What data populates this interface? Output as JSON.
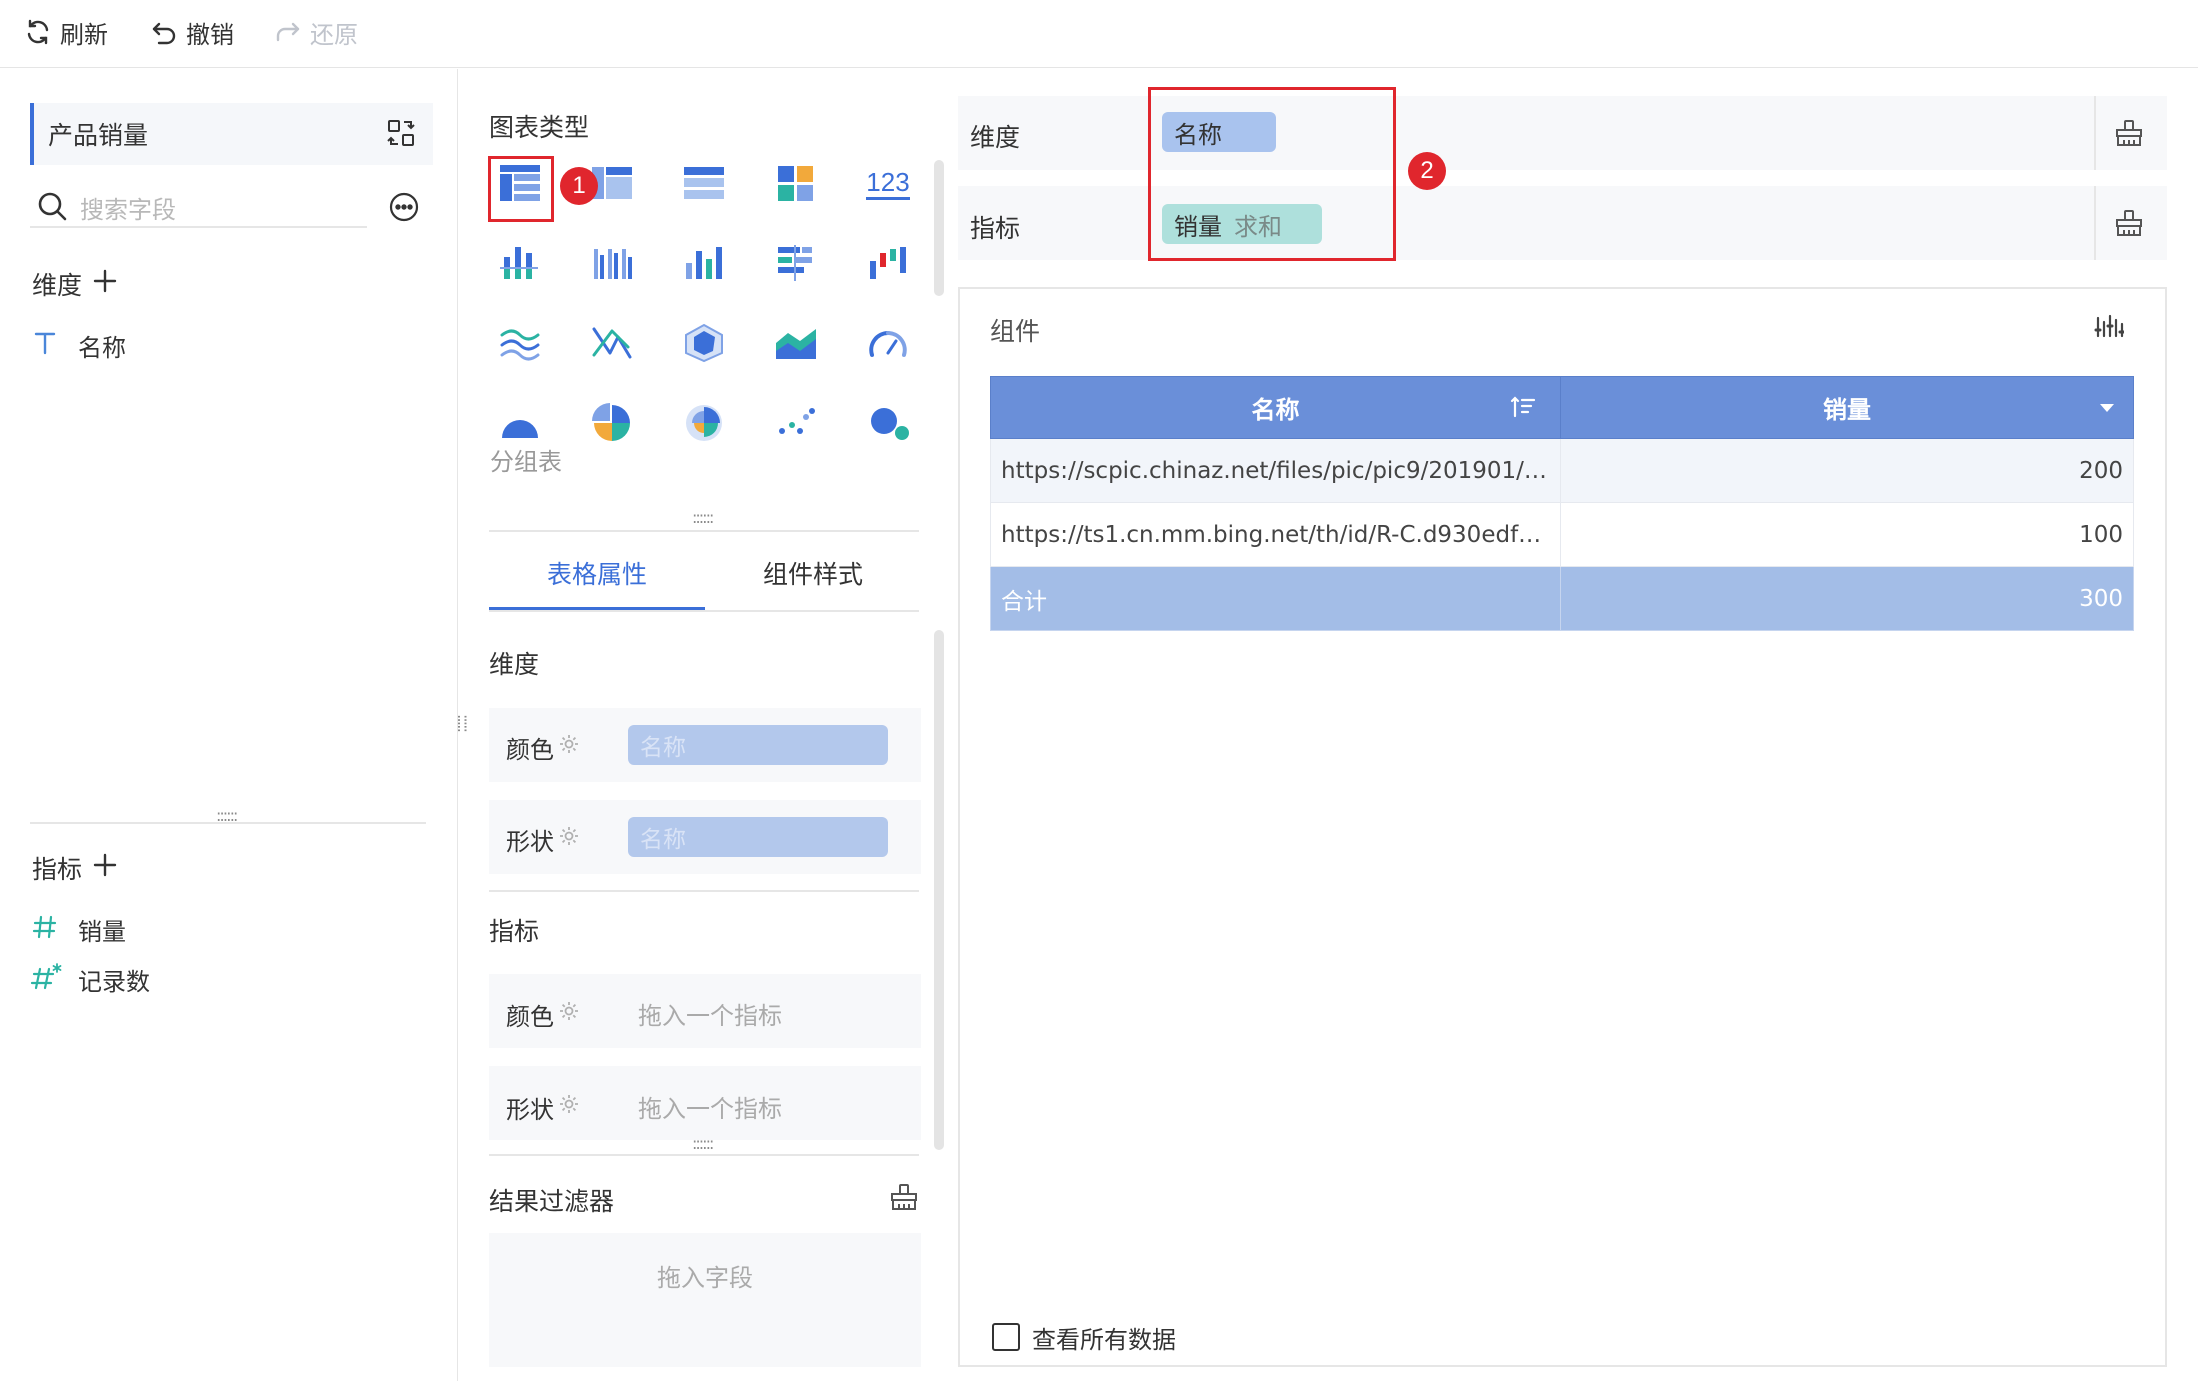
{
  "toolbar": {
    "refresh": "刷新",
    "undo": "撤销",
    "redo": "还原"
  },
  "left": {
    "dataset_title": "产品销量",
    "search_placeholder": "搜索字段",
    "dimension_header": "维度",
    "dimension_fields": [
      "名称"
    ],
    "measure_header": "指标",
    "measure_fields": [
      "销量",
      "记录数"
    ]
  },
  "middle": {
    "chart_type_title": "图表类型",
    "chart_type_caption": "分组表",
    "tabs": [
      "表格属性",
      "组件样式"
    ],
    "active_tab": 0,
    "dimension_section": "维度",
    "measure_section": "指标",
    "color_label": "颜色",
    "shape_label": "形状",
    "dim_color_value": "名称",
    "dim_shape_value": "名称",
    "measure_placeholder": "拖入一个指标",
    "filter_title": "结果过滤器",
    "filter_placeholder": "拖入字段",
    "numeric_icon_text": "123"
  },
  "right": {
    "dimension_label": "维度",
    "measure_label": "指标",
    "dimension_chip": "名称",
    "measure_chip_name": "销量",
    "measure_chip_agg": "求和",
    "component_title": "组件",
    "table": {
      "headers": [
        "名称",
        "销量"
      ],
      "rows": [
        [
          "https://scpic.chinaz.net/files/pic/pic9/201901/bpic...",
          "200"
        ],
        [
          "https://ts1.cn.mm.bing.net/th/id/R-C.d930edfb8e...",
          "100"
        ]
      ],
      "total": [
        "合计",
        "300"
      ]
    },
    "view_all_label": "查看所有数据"
  },
  "annotations": {
    "badge1": "1",
    "badge2": "2"
  },
  "colors": {
    "accent": "#3b6fd8",
    "header_blue": "#6a8fd9",
    "total_blue": "#a3bde7",
    "teal_chip": "#aee0dc",
    "blue_chip": "#a9c3ee",
    "annotation_red": "#e0262d"
  }
}
